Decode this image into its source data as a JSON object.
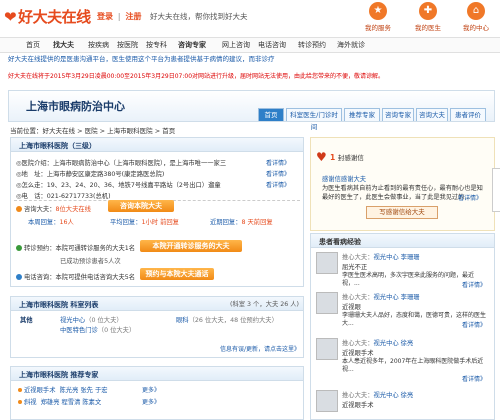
{
  "header": {
    "logo_text": "好大夫在线",
    "login": "登录",
    "sep": "|",
    "register": "注册",
    "slogan": "好大夫在线，帮你找到好大夫",
    "icons": [
      {
        "label": "我的服务",
        "icon": "service-icon"
      },
      {
        "label": "我的医生",
        "icon": "doctor-icon"
      },
      {
        "label": "我的中心",
        "icon": "home-icon"
      }
    ]
  },
  "nav": {
    "items": [
      "首页",
      "找大夫",
      "按疾病",
      "按医院",
      "按专科",
      "咨询专家",
      "网上咨询",
      "电话咨询",
      "转诊预约",
      "海外就诊"
    ]
  },
  "intro": "好大夫在线提供的是医患沟通平台，医生使用这个平台为患者提供基于病情的建议，而非诊疗",
  "notice": "好大夫在线将于2015年3月29日凌晨00:00至2015年3月29日07:00对网站进行升级，届时网站无法使用，由此给您带来的不便，敬请谅解。",
  "hospital": {
    "name": "上海市眼病防治中心",
    "tabs": [
      "首页",
      "科室医生/门诊时间",
      "推荐专家",
      "咨询专家",
      "咨询大夫",
      "患者评价"
    ],
    "breadcrumb": "当前位置：好大夫在线 > 医院 > 上海市眼科医院 > 首页"
  },
  "info": {
    "title": "上海市眼科医院（三级）",
    "rows": [
      {
        "label": "◎医院介绍：",
        "text": "上海市眼病防治中心（上海市眼科医院），是上海市唯一一家三",
        "more": "看详情》"
      },
      {
        "label": "◎地　址：",
        "text": "上海市静安区康定路380号(康定路医总院)",
        "more": "看详情》"
      },
      {
        "label": "◎怎么走：",
        "text": "19、23、24、20、36、地铁7号线嘉平路站（2号出口）遛童",
        "more": "看详情》"
      },
      {
        "label": "◎电　话：",
        "text": "021-62717733(总机)",
        "more": ""
      }
    ],
    "consult_label": "咨询大夫：",
    "consult_count": "8位大夫在线",
    "consult_button": "咨询本院大夫",
    "stats": [
      {
        "label": "本周回复：",
        "value": "16人"
      },
      {
        "label": "平均回复：",
        "value": "1小时 前回复"
      },
      {
        "label": "近期回复：",
        "value": "8 天前回复"
      }
    ],
    "transfer_label": "转诊预约：",
    "transfer_text": "本院可通转诊服务的大夫1名",
    "transfer_button": "本院开通转诊服务的大夫",
    "transfer_note": "已成功预诊患者5人次",
    "phone_label": "电话咨询：",
    "phone_text": "本院可提供电话咨询大夫5名",
    "phone_button": "预约与本院大夫通话"
  },
  "depts": {
    "title": "上海市眼科医院 科室列表",
    "subtitle": "(科室 3 个，大夫 26 人)",
    "col": "其他",
    "items": [
      {
        "name": "视光中心",
        "detail": "（0 位大夫）"
      },
      {
        "name": "中医特色门诊",
        "detail": "（0 位大夫）"
      },
      {
        "name": "眼科",
        "detail": "（26 位大夫，48 位预约大夫）"
      }
    ],
    "footer": "信息有误/更新，请点击这里》"
  },
  "experts": {
    "title": "上海市眼科医院 推荐专家",
    "rows": [
      {
        "tag": "近视眼手术",
        "names": "陈光亮  张先  于宏"
      },
      {
        "tag": "斜视",
        "names": "郑雄亮  程雪清  陈素文"
      }
    ],
    "more": "更多》"
  },
  "thanks": {
    "count_label": "1",
    "count_suffix": "封感谢信",
    "author": "感谢信感谢大夫",
    "text": "为医生看病其自前为止看到的最有责任心，最有耐心也是知最好的医生了，此医生会做事业，当了此是我见过的...",
    "more": "看详情》",
    "button": "写感谢信给大夫"
  },
  "experience": {
    "title": "患者看病经验",
    "items": [
      {
        "role": "推心大夫：",
        "name": "视光中心 李珊珊",
        "topic": "屈光不正",
        "text": "李医生医术高明，多次宇医来此服务的问题，最近视，...",
        "more": "看详情》"
      },
      {
        "role": "推心大夫：",
        "name": "视光中心 李珊珊",
        "topic": "近视眼",
        "text": "李珊珊大夫人品好，态度和蔼，医德可贵，这样的医生大...",
        "more": "看详情》"
      },
      {
        "role": "推心大夫：",
        "name": "视光中心 徐亮",
        "topic": "近视眼手术",
        "text": "本人患近视多年，2007年在上海眼科医院做手术后近视...",
        "more": "看详情》"
      },
      {
        "role": "推心大夫：",
        "name": "视光中心 徐亮",
        "topic": "近视眼手术",
        "text": "",
        "more": ""
      }
    ]
  },
  "colors": {
    "brand": "#e64b1e",
    "link": "#1a5aa8",
    "accent": "#f18a16",
    "header_blue": "#2e7fc8"
  }
}
